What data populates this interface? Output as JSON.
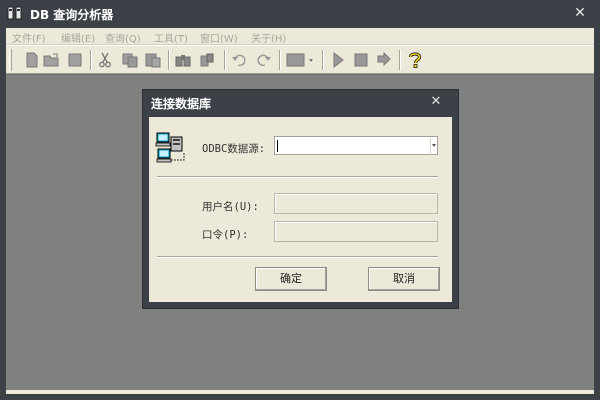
{
  "window": {
    "title": "DB 查询分析器",
    "close_glyph": "✕"
  },
  "menu": [
    {
      "label": "文件(F)"
    },
    {
      "label": "编辑(E)"
    },
    {
      "label": "查询(Q)"
    },
    {
      "label": "工具(T)"
    },
    {
      "label": "窗口(W)"
    },
    {
      "label": "关于(H)"
    }
  ],
  "toolbar": {
    "buttons": [
      "new-file-icon",
      "open-folder-icon",
      "save-icon",
      "cut-icon",
      "copy-icon",
      "paste-icon",
      "find-icon",
      "replace-icon",
      "undo-icon",
      "redo-icon",
      "database-select-icon",
      "run-icon",
      "stop-icon",
      "step-icon",
      "help-icon"
    ]
  },
  "dialog": {
    "title": "连接数据库",
    "close_glyph": "✕",
    "odbc_label": "ODBC数据源:",
    "odbc_value": "",
    "username_label": "用户名(U):",
    "username_value": "",
    "password_label": "口令(P):",
    "password_value": "",
    "ok_label": "确定",
    "cancel_label": "取消"
  },
  "colors": {
    "titlebar": "#3b4147",
    "chrome": "#ece9d8",
    "workspace": "#808080",
    "disabled_text": "#a9a69b"
  }
}
